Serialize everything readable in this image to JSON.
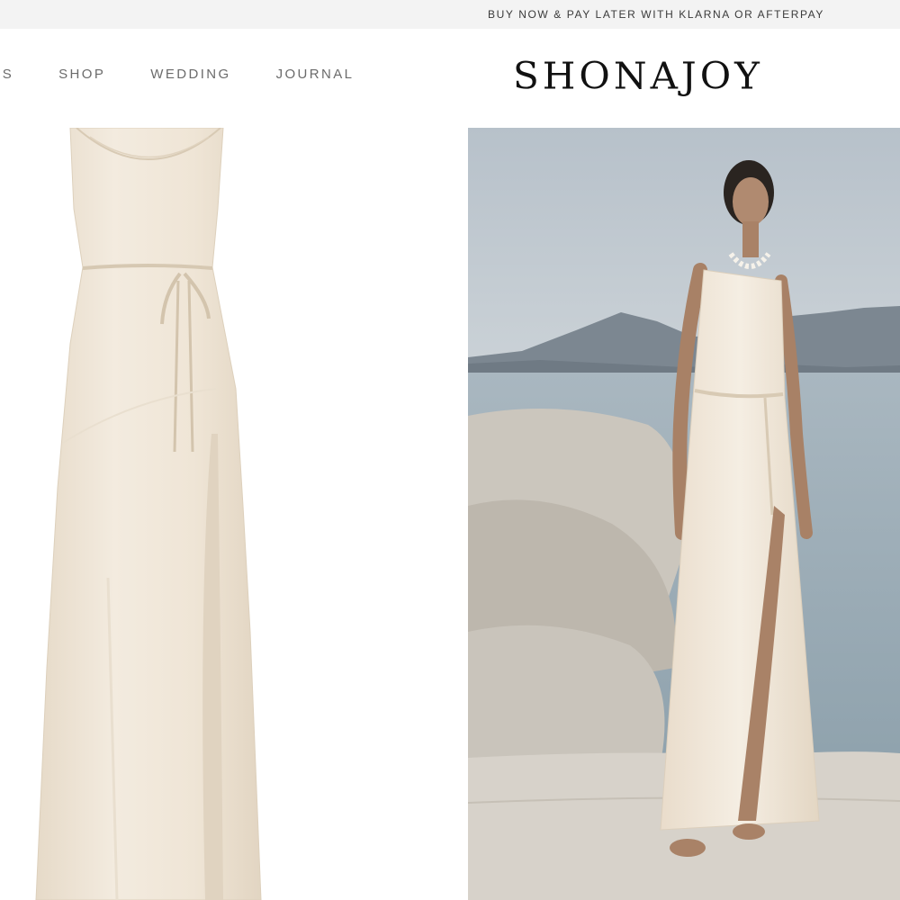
{
  "announcement": {
    "text": "BUY NOW & PAY LATER WITH KLARNA OR AFTERPAY"
  },
  "nav": {
    "items": [
      {
        "label": "LS"
      },
      {
        "label": "SHOP"
      },
      {
        "label": "WEDDING"
      },
      {
        "label": "JOURNAL"
      }
    ]
  },
  "brand": {
    "logo": "SHONAJOY"
  },
  "colors": {
    "announcement_bg": "#f3f3f3",
    "dress": "#efe5d6",
    "sky": "#bcc6cf",
    "sea": "#a7b5be",
    "rock": "#d9d4cc"
  }
}
